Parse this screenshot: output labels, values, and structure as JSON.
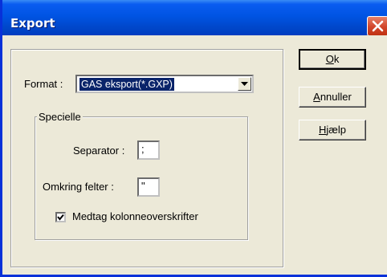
{
  "window": {
    "title": "Export",
    "close_icon": "close-icon",
    "close_color": "#d2452a"
  },
  "format": {
    "label": "Format :",
    "selected": "GAS eksport(*.GXP)"
  },
  "specielle": {
    "legend": "Specielle",
    "separator_label": "Separator :",
    "separator_value": ";",
    "omkring_label": "Omkring felter :",
    "omkring_value": "\"",
    "checkbox_label": "Medtag kolonneoverskrifter",
    "checkbox_checked": true
  },
  "buttons": {
    "ok": "Ok",
    "ok_mnemonic": "O",
    "annuller": "Annuller",
    "annuller_mnemonic": "A",
    "hjaelp": "Hjælp",
    "hjaelp_mnemonic": "H"
  }
}
